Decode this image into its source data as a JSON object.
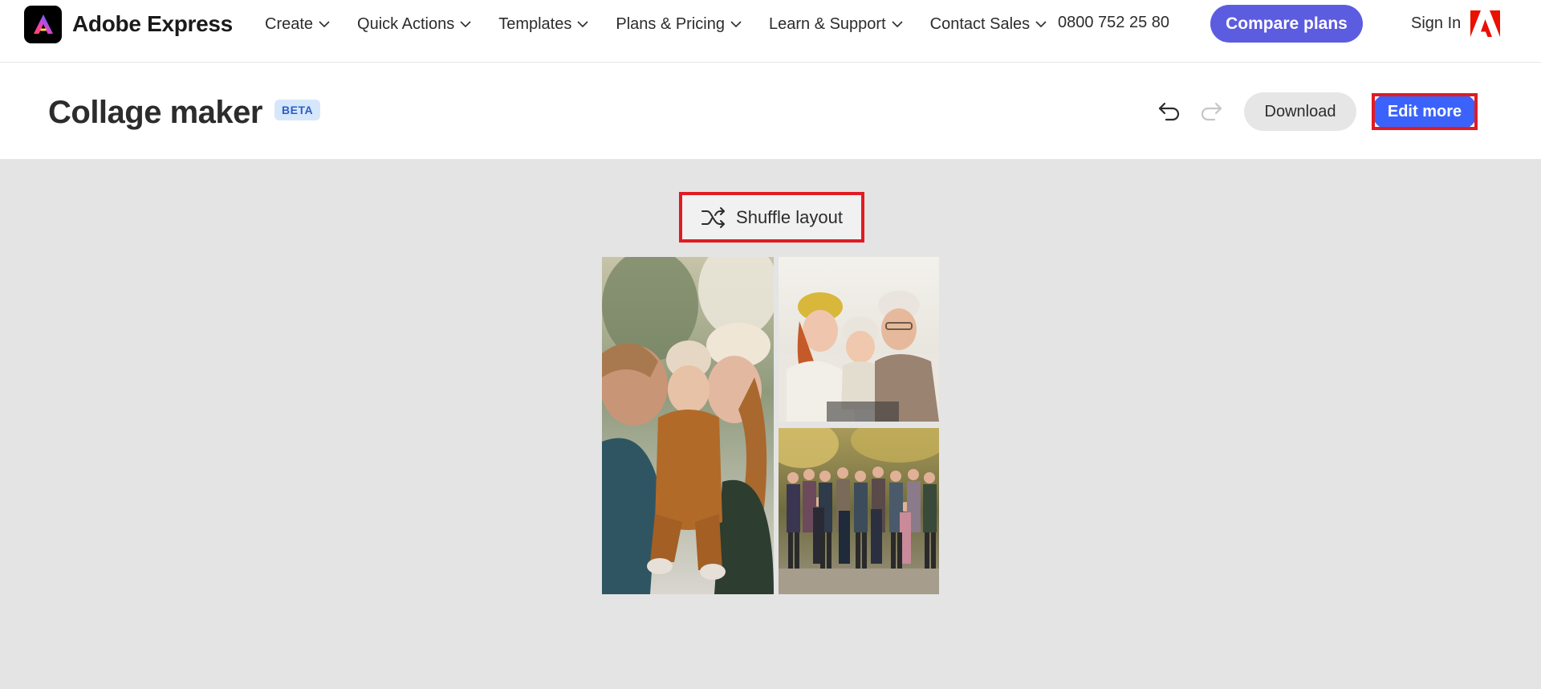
{
  "brand": {
    "name": "Adobe Express",
    "logo_icon": "adobe-express-logo-icon"
  },
  "nav": {
    "items": [
      {
        "label": "Create"
      },
      {
        "label": "Quick Actions"
      },
      {
        "label": "Templates"
      },
      {
        "label": "Plans & Pricing"
      },
      {
        "label": "Learn & Support"
      },
      {
        "label": "Contact Sales"
      }
    ],
    "phone": "0800 752 25 80",
    "compare_label": "Compare plans",
    "signin_label": "Sign In"
  },
  "header": {
    "title": "Collage maker",
    "badge": "BETA",
    "download_label": "Download",
    "edit_more_label": "Edit more"
  },
  "canvas": {
    "shuffle_label": "Shuffle layout",
    "photos": [
      {
        "name": "photo-couple-kissing-baby"
      },
      {
        "name": "photo-family-with-baby"
      },
      {
        "name": "photo-large-family-group"
      }
    ]
  },
  "colors": {
    "accent_purple": "#5c5ce0",
    "edit_blue": "#3b63fb",
    "highlight_red": "#e01b24",
    "canvas_bg": "#e4e4e4",
    "badge_bg": "#d6e7fb",
    "badge_text": "#2d5ec4"
  }
}
